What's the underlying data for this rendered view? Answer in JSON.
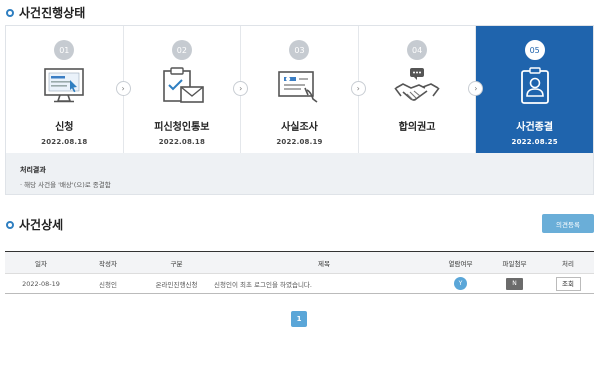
{
  "status_section": {
    "title": "사건진행상태"
  },
  "steps": [
    {
      "num": "01",
      "name": "신청",
      "date": "2022.08.18",
      "icon": "monitor-icon"
    },
    {
      "num": "02",
      "name": "피신청인통보",
      "date": "2022.08.18",
      "icon": "clipboard-mail-icon"
    },
    {
      "num": "03",
      "name": "사실조사",
      "date": "2022.08.19",
      "icon": "document-search-icon"
    },
    {
      "num": "04",
      "name": "합의권고",
      "date": "",
      "icon": "handshake-icon"
    },
    {
      "num": "05",
      "name": "사건종결",
      "date": "2022.08.25",
      "icon": "id-badge-icon"
    }
  ],
  "result": {
    "label": "처리결과",
    "text": "· 해당 사건을 '배상'(으)로 종결함"
  },
  "detail_section": {
    "title": "사건상세",
    "register_button": "의견등록"
  },
  "table": {
    "headers": [
      "일자",
      "작성자",
      "구분",
      "제목",
      "열람여부",
      "파일첨부",
      "처리"
    ],
    "rows": [
      {
        "date": "2022-08-19",
        "author": "신청인",
        "category": "온라인진행신청",
        "subject": "신청인이 최초 로그인을 하였습니다.",
        "read": "Y",
        "file": "N",
        "action": "조회"
      }
    ]
  },
  "pagination": {
    "current": "1"
  },
  "colors": {
    "accent": "#1f64ad",
    "light_accent": "#5aa6d8",
    "inactive_step": "#c6cbd1"
  }
}
